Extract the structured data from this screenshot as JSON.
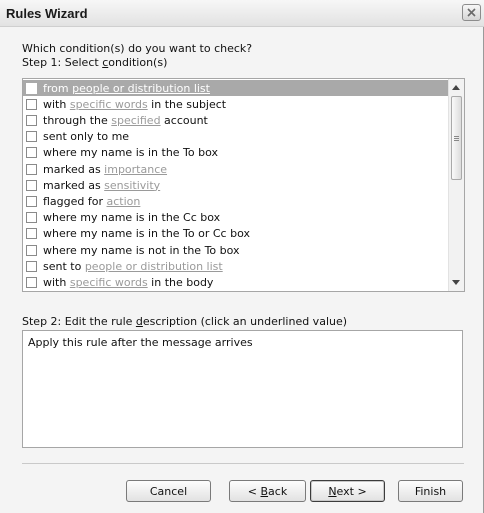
{
  "window": {
    "title": "Rules Wizard"
  },
  "intro": {
    "question": "Which condition(s) do you want to check?",
    "step1_prefix": "Step 1: Select ",
    "step1_access": "c",
    "step1_rest": "ondition(s)"
  },
  "conditions": [
    {
      "before": "from ",
      "link": "people or distribution list",
      "after": "",
      "checked": false,
      "selected": true
    },
    {
      "before": "with ",
      "link": "specific words",
      "after": " in the subject",
      "checked": false,
      "selected": false
    },
    {
      "before": "through the ",
      "link": "specified",
      "after": " account",
      "checked": false,
      "selected": false
    },
    {
      "before": "sent only to me",
      "link": "",
      "after": "",
      "checked": false,
      "selected": false
    },
    {
      "before": "where my name is in the To box",
      "link": "",
      "after": "",
      "checked": false,
      "selected": false
    },
    {
      "before": "marked as ",
      "link": "importance",
      "after": "",
      "checked": false,
      "selected": false
    },
    {
      "before": "marked as ",
      "link": "sensitivity",
      "after": "",
      "checked": false,
      "selected": false
    },
    {
      "before": "flagged for ",
      "link": "action",
      "after": "",
      "checked": false,
      "selected": false
    },
    {
      "before": "where my name is in the Cc box",
      "link": "",
      "after": "",
      "checked": false,
      "selected": false
    },
    {
      "before": "where my name is in the To or Cc box",
      "link": "",
      "after": "",
      "checked": false,
      "selected": false
    },
    {
      "before": "where my name is not in the To box",
      "link": "",
      "after": "",
      "checked": false,
      "selected": false
    },
    {
      "before": "sent to ",
      "link": "people or distribution list",
      "after": "",
      "checked": false,
      "selected": false
    },
    {
      "before": "with ",
      "link": "specific words",
      "after": " in the body",
      "checked": false,
      "selected": false
    }
  ],
  "step2": {
    "prefix": "Step 2: Edit the rule ",
    "access": "d",
    "rest": "escription (click an underlined value)",
    "description": "Apply this rule after the message arrives"
  },
  "buttons": {
    "cancel": "Cancel",
    "back_prefix": "< ",
    "back_access": "B",
    "back_rest": "ack",
    "next_access": "N",
    "next_rest": "ext >",
    "finish": "Finish"
  },
  "icons": {
    "close": "close-icon",
    "scroll_up": "scroll-up-arrow-icon",
    "scroll_down": "scroll-down-arrow-icon"
  },
  "colors": {
    "selected_row": "#a9a9a9",
    "link_text": "#9a9a9a",
    "window_bg": "#f4f4f4"
  }
}
